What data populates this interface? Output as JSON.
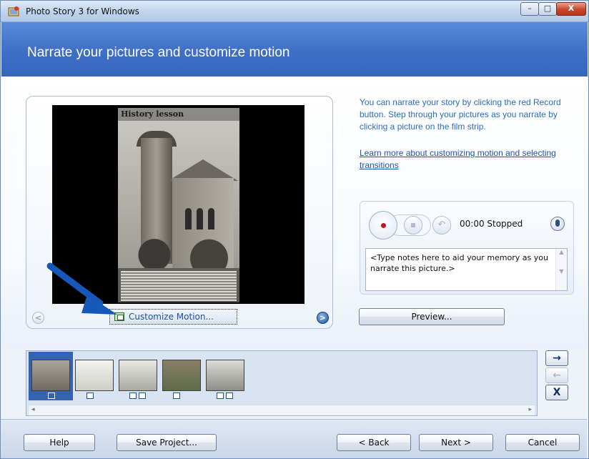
{
  "window": {
    "title": "Photo Story 3 for Windows",
    "close_glyph": "X"
  },
  "header": {
    "title": "Narrate your pictures and customize motion"
  },
  "preview": {
    "photo_caption": "History lesson",
    "customize_motion_label": "Customize Motion...",
    "prev_glyph": "<",
    "next_glyph": ">"
  },
  "help": {
    "text": "You can narrate your story by clicking the red Record button. Step through your pictures as you narrate by clicking a picture on the film strip.",
    "link": "Learn more about customizing motion and selecting transitions"
  },
  "narration": {
    "time": "00:00",
    "status": "Stopped",
    "time_status": "00:00  Stopped",
    "notes_placeholder": "<Type notes here to aid your memory as you narrate this picture.>",
    "undo_glyph": "↶"
  },
  "preview_button": "Preview...",
  "filmstrip": {
    "thumbnails": [
      {
        "name": "history-lesson",
        "selected": true
      },
      {
        "name": "paper-sketch",
        "selected": false
      },
      {
        "name": "building-drawing",
        "selected": false
      },
      {
        "name": "color-photo",
        "selected": false
      },
      {
        "name": "portrait-clipping",
        "selected": false
      }
    ],
    "side_buttons": {
      "forward": "→",
      "back": "←",
      "remove": "X"
    },
    "scroll_left": "◂",
    "scroll_right": "▸"
  },
  "buttons": {
    "help": "Help",
    "save": "Save Project...",
    "back": "< Back",
    "next": "Next >",
    "cancel": "Cancel"
  },
  "colors": {
    "header": "#3e6fc6",
    "link": "#1c56ad",
    "selected": "#3563b1",
    "record": "#c01818"
  },
  "icons": [
    "photostory-app-icon",
    "minimize-icon",
    "maximize-icon",
    "close-icon",
    "customize-motion-icon",
    "record-icon",
    "stop-icon",
    "undo-icon",
    "microphone-icon",
    "edit-icon",
    "transition-icon",
    "arrow-right-icon",
    "arrow-left-icon",
    "remove-icon"
  ]
}
